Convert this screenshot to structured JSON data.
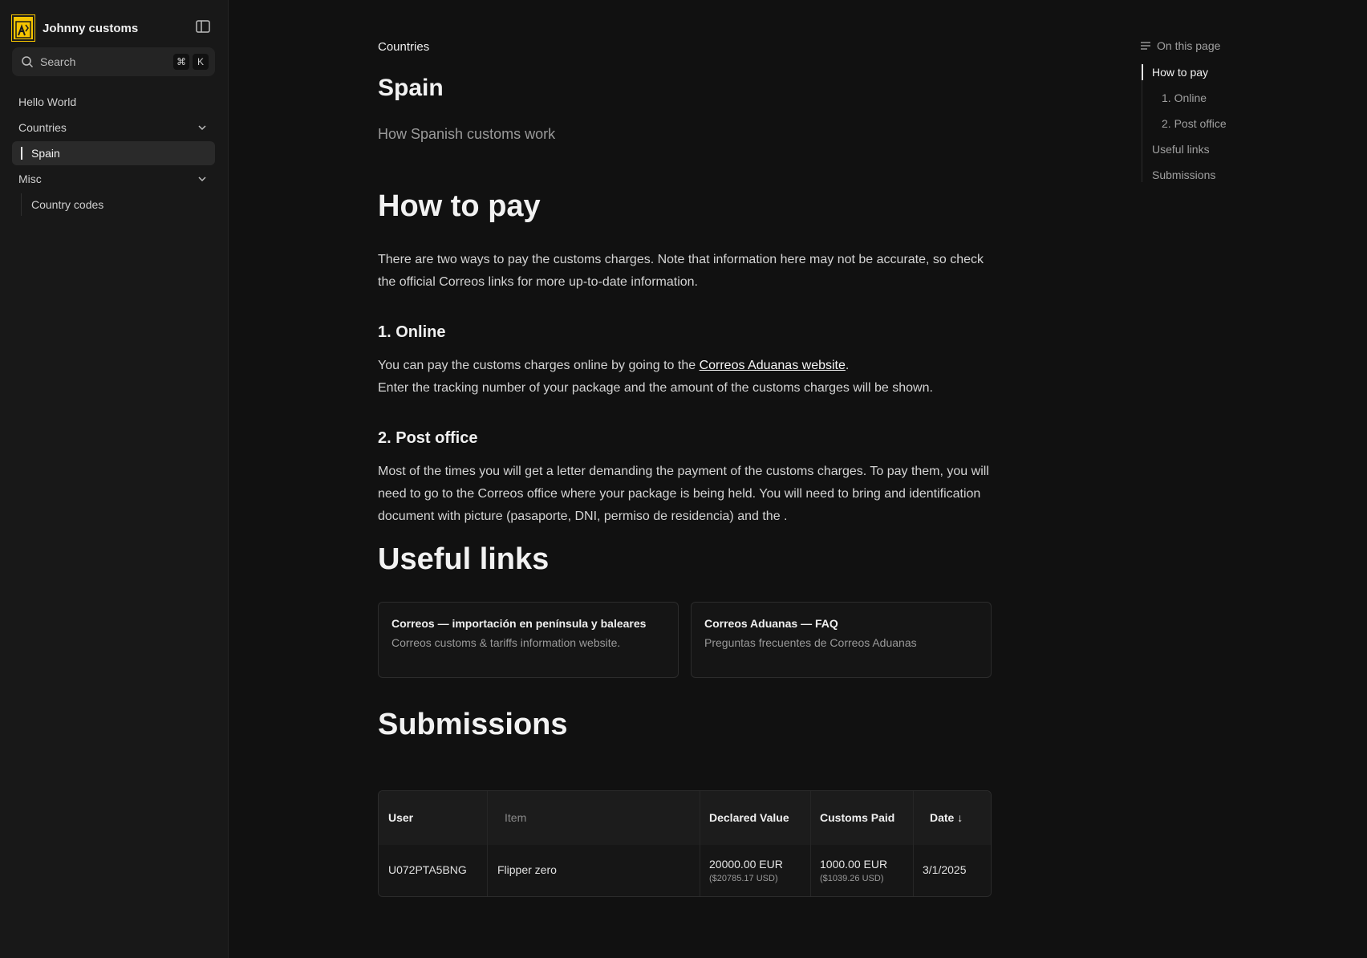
{
  "app": {
    "brand_name": "Johnny customs",
    "search_label": "Search",
    "search_kbd_cmd": "⌘",
    "search_kbd_key": "K"
  },
  "sidebar": {
    "items": [
      {
        "label": "Hello World"
      },
      {
        "label": "Countries",
        "expanded": true
      },
      {
        "label": "Spain",
        "active": true
      },
      {
        "label": "Misc",
        "expanded": true
      },
      {
        "label": "Country codes"
      }
    ]
  },
  "page": {
    "breadcrumb": "Countries",
    "title": "Spain",
    "subtitle": "How Spanish customs work"
  },
  "content": {
    "how_to_pay": {
      "heading": "How to pay",
      "intro": "There are two ways to pay the customs charges. Note that information here may not be accurate, so check the official Correos links for more up-to-date information.",
      "online": {
        "heading": "1. Online",
        "text_before_link": "You can pay the customs charges online by going to the ",
        "link_text": "Correos Aduanas website",
        "text_after_link": ".",
        "line2": "Enter the tracking number of your package and the amount of the customs charges will be shown."
      },
      "post_office": {
        "heading": "2. Post office",
        "text": "Most of the times you will get a letter demanding the payment of the customs charges. To pay them, you will need to go to the Correos office where your package is being held. You will need to bring and identification document with picture (pasaporte, DNI, permiso de residencia) and the ."
      }
    },
    "useful_links": {
      "heading": "Useful links",
      "cards": [
        {
          "title": "Correos — importación en península y baleares",
          "description": "Correos customs & tariffs information website."
        },
        {
          "title": "Correos Aduanas — FAQ",
          "description": "Preguntas frecuentes de Correos Aduanas"
        }
      ]
    },
    "submissions": {
      "heading": "Submissions",
      "columns": [
        "User",
        "Item",
        "Declared Value",
        "Customs Paid",
        "Date ↓"
      ],
      "rows": [
        {
          "user": "U072PTA5BNG",
          "item": "Flipper zero",
          "declared_value": "20000.00 EUR",
          "declared_value_usd": "($20785.17 USD)",
          "customs_paid": "1000.00 EUR",
          "customs_paid_usd": "($1039.26 USD)",
          "date": "3/1/2025"
        }
      ]
    }
  },
  "toc": {
    "heading": "On this page",
    "items": [
      {
        "label": "How to pay",
        "active": true
      },
      {
        "label": "1. Online"
      },
      {
        "label": "2. Post office"
      },
      {
        "label": "Useful links"
      },
      {
        "label": "Submissions"
      }
    ]
  },
  "colors": {
    "background": "#111111",
    "sidebar": "#181818",
    "logo_accent": "#f5c400"
  }
}
